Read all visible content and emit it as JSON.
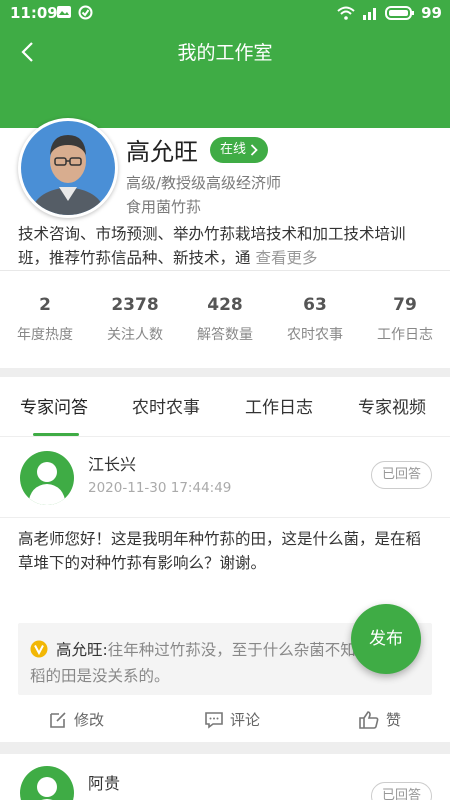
{
  "status_bar": {
    "time": "11:09",
    "battery": "99"
  },
  "header": {
    "title": "我的工作室"
  },
  "profile": {
    "name": "高允旺",
    "status": "在线",
    "title": "高级/教授级高级经济师",
    "field": "食用菌竹荪",
    "bio": "技术咨询、市场预测、举办竹荪栽培技术和加工技术培训班，推荐竹荪信品种、新技术，通",
    "bio_more": "查看更多"
  },
  "stats": [
    {
      "value": "2",
      "label": "年度热度"
    },
    {
      "value": "2378",
      "label": "关注人数"
    },
    {
      "value": "428",
      "label": "解答数量"
    },
    {
      "value": "63",
      "label": "农时农事"
    },
    {
      "value": "79",
      "label": "工作日志"
    }
  ],
  "tabs": [
    {
      "label": "专家问答",
      "active": true
    },
    {
      "label": "农时农事"
    },
    {
      "label": "工作日志"
    },
    {
      "label": "专家视频"
    }
  ],
  "questions": [
    {
      "asker": "江长兴",
      "time": "2020-11-30 17:44:49",
      "badge": "已回答",
      "text": "高老师您好！这是我明年种竹荪的田，这是什么菌，是在稻草堆下的对种竹荪有影响么？谢谢。",
      "answerer": "高允旺:",
      "answer": "往年种过竹荪没，至于什么杂菌不知道，种水稻的田是没关系的。",
      "actions": {
        "edit": "修改",
        "comment": "评论",
        "like": "赞"
      }
    },
    {
      "asker": "阿贵",
      "badge": "已回答"
    }
  ],
  "fab": {
    "label": "发布"
  },
  "colors": {
    "brand_green": "#3fac45"
  }
}
